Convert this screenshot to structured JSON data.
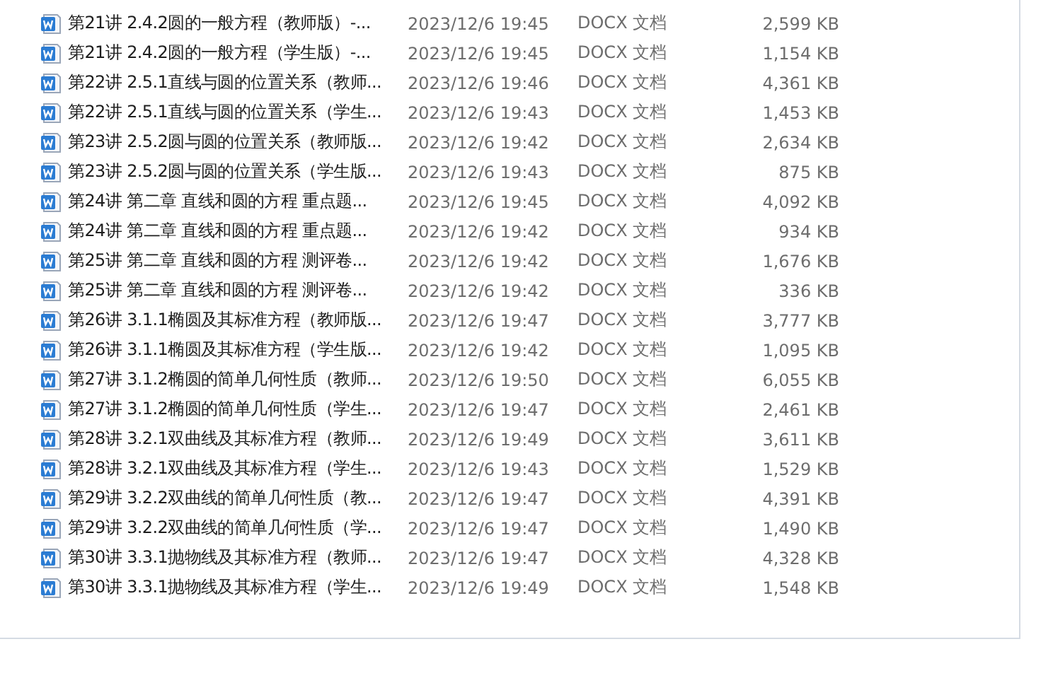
{
  "files": [
    {
      "name": "第21讲 2.4.2圆的一般方程（教师版）-...",
      "modified": "2023/12/6 19:45",
      "type": "DOCX 文档",
      "size": "2,599 KB"
    },
    {
      "name": "第21讲 2.4.2圆的一般方程（学生版）-...",
      "modified": "2023/12/6 19:45",
      "type": "DOCX 文档",
      "size": "1,154 KB"
    },
    {
      "name": "第22讲 2.5.1直线与圆的位置关系（教师...",
      "modified": "2023/12/6 19:46",
      "type": "DOCX 文档",
      "size": "4,361 KB"
    },
    {
      "name": "第22讲 2.5.1直线与圆的位置关系（学生...",
      "modified": "2023/12/6 19:43",
      "type": "DOCX 文档",
      "size": "1,453 KB"
    },
    {
      "name": "第23讲 2.5.2圆与圆的位置关系（教师版...",
      "modified": "2023/12/6 19:42",
      "type": "DOCX 文档",
      "size": "2,634 KB"
    },
    {
      "name": "第23讲 2.5.2圆与圆的位置关系（学生版...",
      "modified": "2023/12/6 19:43",
      "type": "DOCX 文档",
      "size": "875 KB"
    },
    {
      "name": "第24讲 第二章 直线和圆的方程 重点题...",
      "modified": "2023/12/6 19:45",
      "type": "DOCX 文档",
      "size": "4,092 KB"
    },
    {
      "name": "第24讲 第二章 直线和圆的方程 重点题...",
      "modified": "2023/12/6 19:42",
      "type": "DOCX 文档",
      "size": "934 KB"
    },
    {
      "name": "第25讲 第二章 直线和圆的方程 测评卷...",
      "modified": "2023/12/6 19:42",
      "type": "DOCX 文档",
      "size": "1,676 KB"
    },
    {
      "name": "第25讲 第二章 直线和圆的方程 测评卷...",
      "modified": "2023/12/6 19:42",
      "type": "DOCX 文档",
      "size": "336 KB"
    },
    {
      "name": "第26讲 3.1.1椭圆及其标准方程（教师版...",
      "modified": "2023/12/6 19:47",
      "type": "DOCX 文档",
      "size": "3,777 KB"
    },
    {
      "name": "第26讲 3.1.1椭圆及其标准方程（学生版...",
      "modified": "2023/12/6 19:42",
      "type": "DOCX 文档",
      "size": "1,095 KB"
    },
    {
      "name": "第27讲 3.1.2椭圆的简单几何性质（教师...",
      "modified": "2023/12/6 19:50",
      "type": "DOCX 文档",
      "size": "6,055 KB"
    },
    {
      "name": "第27讲 3.1.2椭圆的简单几何性质（学生...",
      "modified": "2023/12/6 19:47",
      "type": "DOCX 文档",
      "size": "2,461 KB"
    },
    {
      "name": "第28讲 3.2.1双曲线及其标准方程（教师...",
      "modified": "2023/12/6 19:49",
      "type": "DOCX 文档",
      "size": "3,611 KB"
    },
    {
      "name": "第28讲 3.2.1双曲线及其标准方程（学生...",
      "modified": "2023/12/6 19:43",
      "type": "DOCX 文档",
      "size": "1,529 KB"
    },
    {
      "name": "第29讲 3.2.2双曲线的简单几何性质（教...",
      "modified": "2023/12/6 19:47",
      "type": "DOCX 文档",
      "size": "4,391 KB"
    },
    {
      "name": "第29讲 3.2.2双曲线的简单几何性质（学...",
      "modified": "2023/12/6 19:47",
      "type": "DOCX 文档",
      "size": "1,490 KB"
    },
    {
      "name": "第30讲 3.3.1抛物线及其标准方程（教师...",
      "modified": "2023/12/6 19:47",
      "type": "DOCX 文档",
      "size": "4,328 KB"
    },
    {
      "name": "第30讲 3.3.1抛物线及其标准方程（学生...",
      "modified": "2023/12/6 19:49",
      "type": "DOCX 文档",
      "size": "1,548 KB"
    }
  ]
}
